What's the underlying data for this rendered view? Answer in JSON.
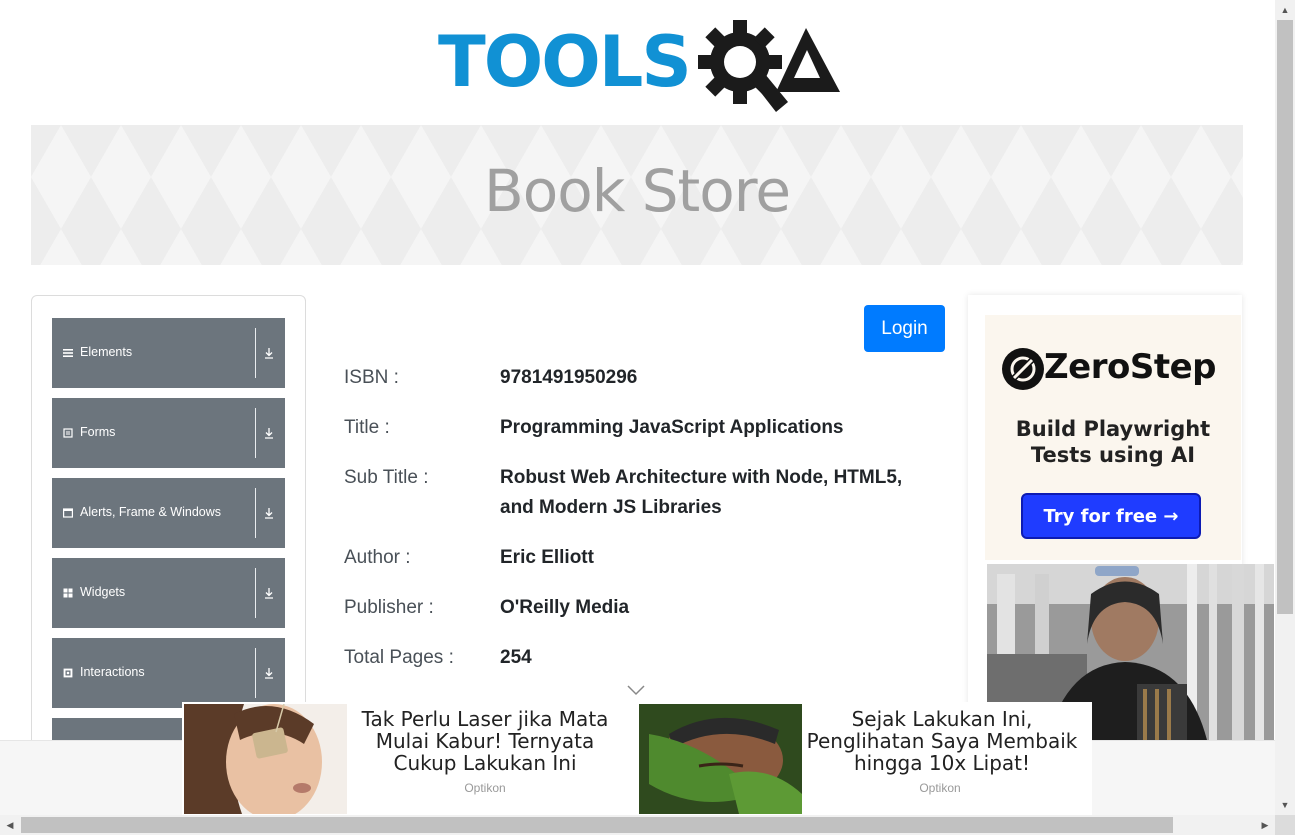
{
  "header": {
    "logo_text": "TOOLS",
    "logo_alt": "ToolsQA"
  },
  "banner": {
    "title": "Book Store"
  },
  "sidebar": {
    "items": [
      {
        "label": "Elements",
        "icon": "list-icon"
      },
      {
        "label": "Forms",
        "icon": "form-icon"
      },
      {
        "label": "Alerts, Frame & Windows",
        "icon": "window-icon"
      },
      {
        "label": "Widgets",
        "icon": "widgets-icon"
      },
      {
        "label": "Interactions",
        "icon": "interactions-icon"
      }
    ]
  },
  "login": {
    "label": "Login"
  },
  "book": {
    "fields": [
      {
        "label": "ISBN :",
        "value": "9781491950296"
      },
      {
        "label": "Title :",
        "value": "Programming JavaScript Applications"
      },
      {
        "label": "Sub Title :",
        "value": "Robust Web Architecture with Node, HTML5, and Modern JS Libraries"
      },
      {
        "label": "Author :",
        "value": "Eric Elliott"
      },
      {
        "label": "Publisher :",
        "value": "O'Reilly Media"
      },
      {
        "label": "Total Pages :",
        "value": "254"
      }
    ]
  },
  "side_ad": {
    "brand": "ZeroStep",
    "tagline": "Build Playwright Tests using AI",
    "cta": "Try for free →"
  },
  "bottom_ad": {
    "items": [
      {
        "headline": "Tak Perlu Laser jika Mata Mulai Kabur! Ternyata Cukup Lakukan Ini",
        "source": "Optikon"
      },
      {
        "headline": "Sejak Lakukan Ini, Penglihatan Saya Membaik hingga 10x Lipat!",
        "source": "Optikon"
      }
    ]
  },
  "colors": {
    "brand_blue": "#1191d4",
    "primary": "#007bff",
    "menu_bg": "#6c757d",
    "cta_blue": "#1f3cff"
  }
}
